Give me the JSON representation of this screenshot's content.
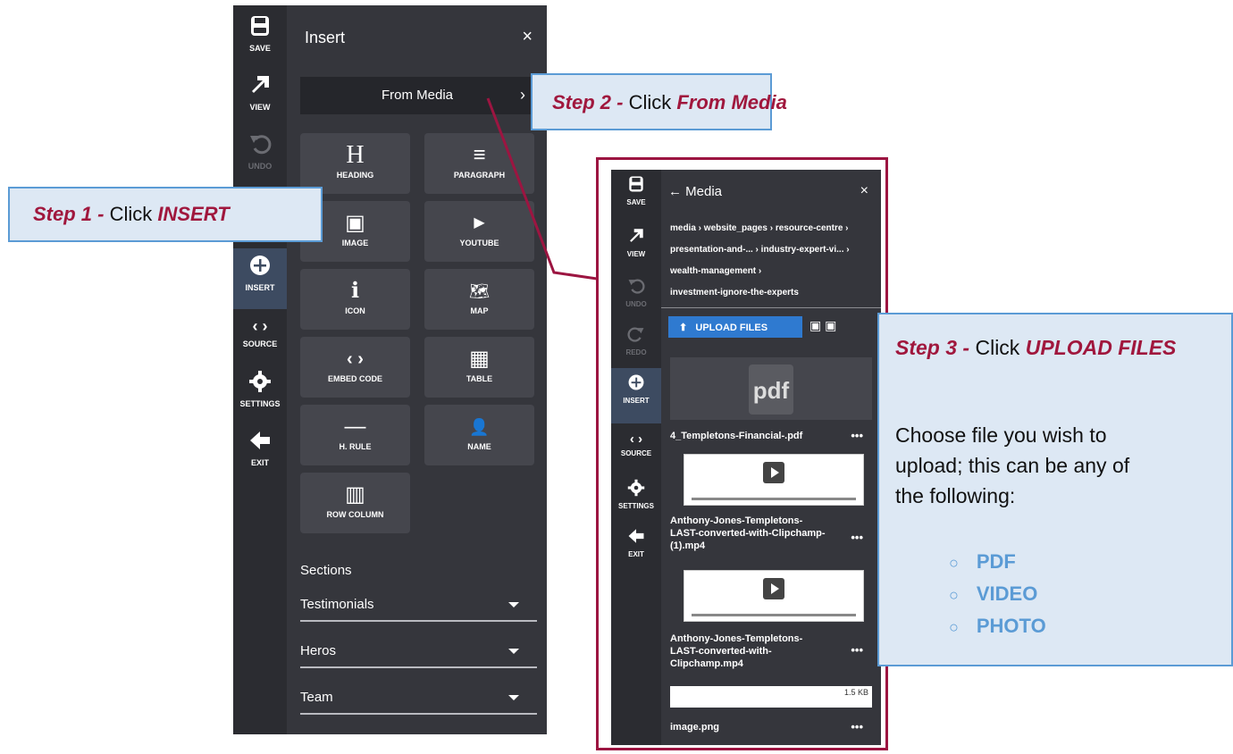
{
  "editor": {
    "rail": [
      {
        "label": "SAVE"
      },
      {
        "label": "VIEW"
      },
      {
        "label": "UNDO"
      },
      {
        "label": "INSERT"
      },
      {
        "label": "SOURCE"
      },
      {
        "label": "SETTINGS"
      },
      {
        "label": "EXIT"
      }
    ],
    "panel_title": "Insert",
    "close": "×",
    "from_media": "From Media",
    "tiles": [
      {
        "label": "HEADING",
        "icon": "H"
      },
      {
        "label": "PARAGRAPH",
        "icon": "≡"
      },
      {
        "label": "IMAGE",
        "icon": "▣"
      },
      {
        "label": "YOUTUBE",
        "icon": "▶"
      },
      {
        "label": "ICON",
        "icon": "ℹ"
      },
      {
        "label": "MAP",
        "icon": "🗺"
      },
      {
        "label": "EMBED CODE",
        "icon": "‹ ›"
      },
      {
        "label": "TABLE",
        "icon": "▦"
      },
      {
        "label": "H. RULE",
        "icon": "—"
      },
      {
        "label": "NAME",
        "icon": "👤"
      },
      {
        "label": "ROW COLUMN",
        "icon": "▥"
      }
    ],
    "sections_label": "Sections",
    "accordions": [
      "Testimonials",
      "Heros",
      "Team"
    ]
  },
  "callouts": {
    "step1_prefix": "Step 1 -",
    "step1_text": " Click ",
    "step1_target": "INSERT",
    "step2_prefix": "Step 2 -",
    "step2_text": " Click ",
    "step2_target": "From Media",
    "step3_prefix": "Step 3 -",
    "step3_text": " Click ",
    "step3_target": "UPLOAD FILES",
    "step3_body": "Choose file you wish to upload; this can be any of the following:",
    "bullets": [
      "PDF",
      "VIDEO",
      "PHOTO"
    ]
  },
  "media": {
    "rail": [
      {
        "label": "SAVE"
      },
      {
        "label": "VIEW"
      },
      {
        "label": "UNDO"
      },
      {
        "label": "REDO"
      },
      {
        "label": "INSERT"
      },
      {
        "label": "SOURCE"
      },
      {
        "label": "SETTINGS"
      },
      {
        "label": "EXIT"
      }
    ],
    "title": "← Media",
    "close": "×",
    "breadcrumb": [
      "media › website_pages › resource-centre ›",
      "presentation-and-...  › industry-expert-vi...  ›",
      "wealth-management ›",
      "investment-ignore-the-experts"
    ],
    "upload_label": "UPLOAD FILES",
    "files": [
      {
        "name": "4_Templetons-Financial-.pdf",
        "thumb": "pdf"
      },
      {
        "name": "Anthony-Jones-Templetons-LAST-converted-with-Clipchamp-(1).mp4"
      },
      {
        "name": "Anthony-Jones-Templetons-LAST-converted-with-Clipchamp.mp4"
      },
      {
        "name": "image.png",
        "size": "1.5 KB"
      }
    ],
    "more": "•••"
  }
}
